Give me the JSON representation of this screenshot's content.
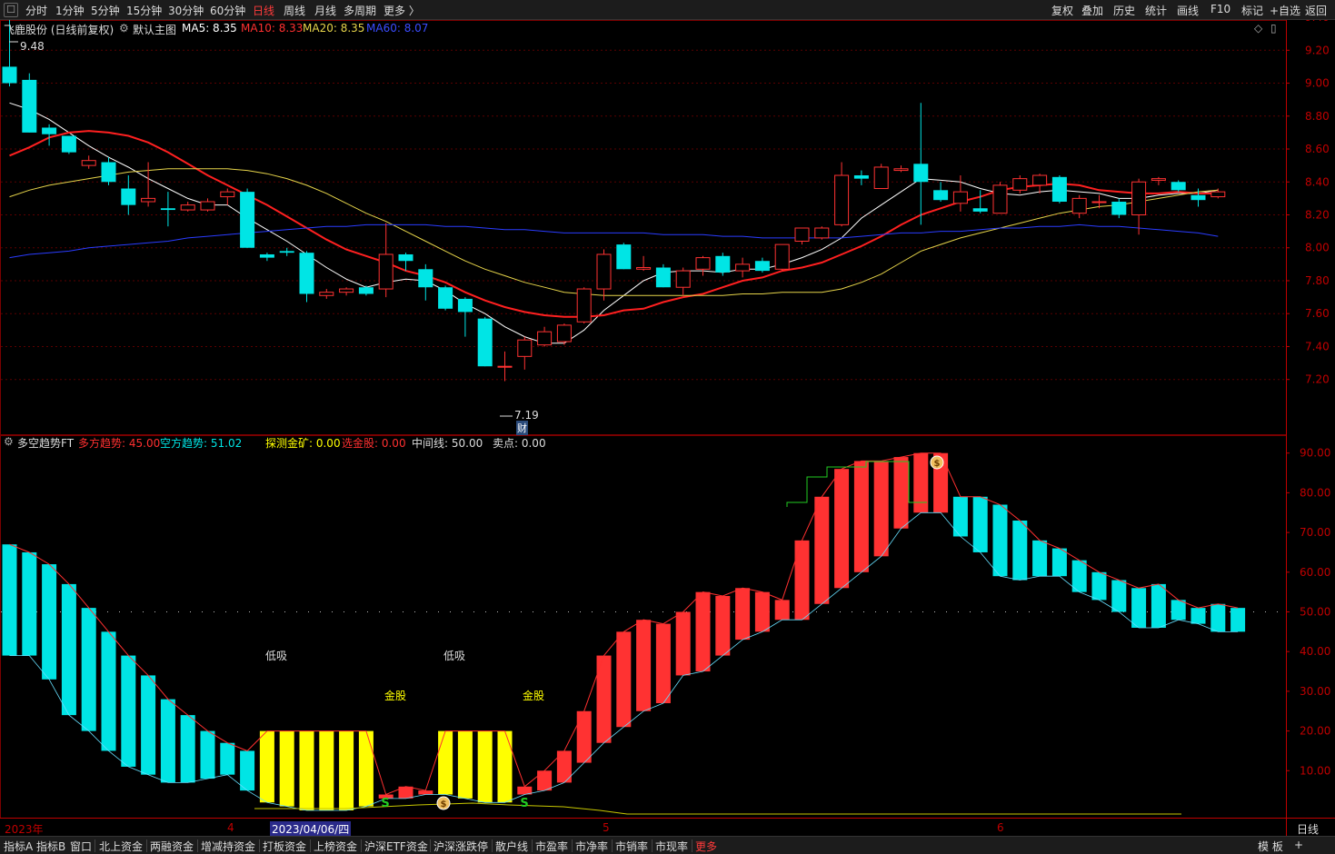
{
  "toolbar": {
    "back_icon": "back-arrow-icon",
    "periods": [
      "分时",
      "1分钟",
      "5分钟",
      "15分钟",
      "30分钟",
      "60分钟",
      "日线",
      "周线",
      "月线",
      "多周期",
      "更多 〉"
    ],
    "active_period": "日线",
    "right_tools": [
      "复权",
      "叠加",
      "历史",
      "统计",
      "画线",
      "F10",
      "标记",
      "+自选",
      "返回"
    ]
  },
  "main_panel": {
    "stock_title": "飞鹿股份 (日线前复权)",
    "template_label": "默认主图",
    "ma5_label": "MA5: 8.35",
    "ma10_label": "MA10: 8.33",
    "ma20_label": "MA20: 8.35",
    "ma60_label": "MA60: 8.07",
    "high_marker": "9.48",
    "low_marker": "7.19",
    "finance_badge": "财"
  },
  "sub_panel": {
    "indicator_name": "多空趋势FT",
    "bull_label": "多方趋势: 45.00",
    "bear_label": "空方趋势: 51.02",
    "probe_label": "探测金矿: 0.00",
    "pick_label": "选金股: 0.00",
    "mid_label": "中间线: 50.00",
    "sell_label": "卖点: 0.00",
    "annotations": [
      {
        "text": "低吸",
        "kind": "low_buy"
      },
      {
        "text": "低吸",
        "kind": "low_buy"
      },
      {
        "text": "金股",
        "kind": "gold"
      },
      {
        "text": "金股",
        "kind": "gold"
      }
    ]
  },
  "xaxis": {
    "labels": [
      "2023年",
      "4",
      "2023/04/06/四",
      "5",
      "6"
    ],
    "period_label": "日线"
  },
  "bottom_tabs": [
    "指标A",
    "指标B",
    "窗口",
    "北上资金",
    "两融资金",
    "增减持资金",
    "打板资金",
    "上榜资金",
    "沪深ETF资金",
    "沪深涨跌停",
    "散户线",
    "市盈率",
    "市净率",
    "市销率",
    "市现率",
    "更多"
  ],
  "bottom_right": [
    "模 板",
    "+"
  ],
  "colors": {
    "up": "#ff3232",
    "down": "#00e5e5",
    "ma5": "#ffffff",
    "ma10": "#ff2020",
    "ma20": "#e6d44a",
    "ma60": "#2a3cff",
    "yellow_bar": "#ffff00",
    "axis": "#c00000"
  },
  "chart_data": [
    {
      "type": "candlestick",
      "title": "飞鹿股份 (日线前复权)",
      "ylim": [
        7.1,
        9.6
      ],
      "yticks": [
        7.2,
        7.4,
        7.6,
        7.8,
        8.0,
        8.2,
        8.4,
        8.6,
        8.8,
        9.0,
        9.2,
        9.4
      ],
      "candles": [
        {
          "o": 9.1,
          "h": 9.48,
          "l": 8.98,
          "c": 9.0
        },
        {
          "o": 9.02,
          "h": 9.06,
          "l": 8.7,
          "c": 8.7
        },
        {
          "o": 8.73,
          "h": 8.75,
          "l": 8.62,
          "c": 8.69
        },
        {
          "o": 8.68,
          "h": 8.68,
          "l": 8.57,
          "c": 8.58
        },
        {
          "o": 8.5,
          "h": 8.56,
          "l": 8.48,
          "c": 8.53
        },
        {
          "o": 8.52,
          "h": 8.55,
          "l": 8.38,
          "c": 8.4
        },
        {
          "o": 8.36,
          "h": 8.44,
          "l": 8.2,
          "c": 8.26
        },
        {
          "o": 8.28,
          "h": 8.52,
          "l": 8.25,
          "c": 8.3
        },
        {
          "o": 8.24,
          "h": 8.34,
          "l": 8.13,
          "c": 8.23
        },
        {
          "o": 8.23,
          "h": 8.28,
          "l": 8.22,
          "c": 8.26
        },
        {
          "o": 8.23,
          "h": 8.3,
          "l": 8.22,
          "c": 8.28
        },
        {
          "o": 8.31,
          "h": 8.36,
          "l": 8.26,
          "c": 8.34
        },
        {
          "o": 8.34,
          "h": 8.36,
          "l": 8.0,
          "c": 8.0
        },
        {
          "o": 7.96,
          "h": 7.97,
          "l": 7.92,
          "c": 7.94
        },
        {
          "o": 7.98,
          "h": 8.0,
          "l": 7.95,
          "c": 7.97
        },
        {
          "o": 7.97,
          "h": 7.98,
          "l": 7.67,
          "c": 7.72
        },
        {
          "o": 7.71,
          "h": 7.75,
          "l": 7.69,
          "c": 7.73
        },
        {
          "o": 7.73,
          "h": 7.76,
          "l": 7.71,
          "c": 7.75
        },
        {
          "o": 7.76,
          "h": 7.77,
          "l": 7.71,
          "c": 7.72
        },
        {
          "o": 7.75,
          "h": 8.15,
          "l": 7.7,
          "c": 7.96
        },
        {
          "o": 7.96,
          "h": 7.97,
          "l": 7.86,
          "c": 7.92
        },
        {
          "o": 7.87,
          "h": 7.9,
          "l": 7.68,
          "c": 7.76
        },
        {
          "o": 7.76,
          "h": 7.77,
          "l": 7.62,
          "c": 7.63
        },
        {
          "o": 7.69,
          "h": 7.7,
          "l": 7.46,
          "c": 7.61
        },
        {
          "o": 7.57,
          "h": 7.58,
          "l": 7.28,
          "c": 7.28
        },
        {
          "o": 7.28,
          "h": 7.37,
          "l": 7.19,
          "c": 7.28
        },
        {
          "o": 7.34,
          "h": 7.46,
          "l": 7.26,
          "c": 7.44
        },
        {
          "o": 7.41,
          "h": 7.52,
          "l": 7.4,
          "c": 7.49
        },
        {
          "o": 7.43,
          "h": 7.54,
          "l": 7.41,
          "c": 7.53
        },
        {
          "o": 7.55,
          "h": 7.76,
          "l": 7.54,
          "c": 7.75
        },
        {
          "o": 7.75,
          "h": 7.99,
          "l": 7.68,
          "c": 7.96
        },
        {
          "o": 8.02,
          "h": 8.03,
          "l": 7.87,
          "c": 7.87
        },
        {
          "o": 7.87,
          "h": 7.95,
          "l": 7.86,
          "c": 7.88
        },
        {
          "o": 7.88,
          "h": 7.9,
          "l": 7.76,
          "c": 7.76
        },
        {
          "o": 7.76,
          "h": 7.88,
          "l": 7.71,
          "c": 7.86
        },
        {
          "o": 7.87,
          "h": 7.95,
          "l": 7.83,
          "c": 7.94
        },
        {
          "o": 7.95,
          "h": 7.97,
          "l": 7.83,
          "c": 7.85
        },
        {
          "o": 7.86,
          "h": 7.94,
          "l": 7.82,
          "c": 7.9
        },
        {
          "o": 7.92,
          "h": 7.94,
          "l": 7.85,
          "c": 7.86
        },
        {
          "o": 7.87,
          "h": 8.02,
          "l": 7.86,
          "c": 8.02
        },
        {
          "o": 8.04,
          "h": 8.12,
          "l": 8.02,
          "c": 8.12
        },
        {
          "o": 8.06,
          "h": 8.13,
          "l": 8.05,
          "c": 8.12
        },
        {
          "o": 8.14,
          "h": 8.52,
          "l": 8.13,
          "c": 8.44
        },
        {
          "o": 8.44,
          "h": 8.47,
          "l": 8.38,
          "c": 8.42
        },
        {
          "o": 8.36,
          "h": 8.51,
          "l": 8.36,
          "c": 8.49
        },
        {
          "o": 8.47,
          "h": 8.5,
          "l": 8.46,
          "c": 8.48
        },
        {
          "o": 8.51,
          "h": 8.88,
          "l": 8.14,
          "c": 8.4
        },
        {
          "o": 8.35,
          "h": 8.4,
          "l": 8.28,
          "c": 8.29
        },
        {
          "o": 8.27,
          "h": 8.44,
          "l": 8.22,
          "c": 8.34
        },
        {
          "o": 8.24,
          "h": 8.35,
          "l": 8.21,
          "c": 8.22
        },
        {
          "o": 8.21,
          "h": 8.4,
          "l": 8.21,
          "c": 8.38
        },
        {
          "o": 8.35,
          "h": 8.44,
          "l": 8.33,
          "c": 8.42
        },
        {
          "o": 8.38,
          "h": 8.45,
          "l": 8.33,
          "c": 8.44
        },
        {
          "o": 8.43,
          "h": 8.44,
          "l": 8.27,
          "c": 8.28
        },
        {
          "o": 8.21,
          "h": 8.32,
          "l": 8.18,
          "c": 8.3
        },
        {
          "o": 8.28,
          "h": 8.32,
          "l": 8.24,
          "c": 8.28
        },
        {
          "o": 8.28,
          "h": 8.3,
          "l": 8.18,
          "c": 8.2
        },
        {
          "o": 8.2,
          "h": 8.42,
          "l": 8.08,
          "c": 8.4
        },
        {
          "o": 8.41,
          "h": 8.43,
          "l": 8.38,
          "c": 8.42
        },
        {
          "o": 8.4,
          "h": 8.41,
          "l": 8.34,
          "c": 8.35
        },
        {
          "o": 8.32,
          "h": 8.36,
          "l": 8.25,
          "c": 8.29
        },
        {
          "o": 8.31,
          "h": 8.36,
          "l": 8.3,
          "c": 8.34
        }
      ],
      "series": [
        {
          "name": "MA5",
          "values": [
            8.88,
            8.84,
            8.78,
            8.7,
            8.62,
            8.55,
            8.49,
            8.42,
            8.36,
            8.3,
            8.26,
            8.26,
            8.18,
            8.11,
            8.04,
            7.96,
            7.88,
            7.81,
            7.76,
            7.79,
            7.81,
            7.8,
            7.74,
            7.66,
            7.6,
            7.52,
            7.46,
            7.42,
            7.42,
            7.5,
            7.62,
            7.71,
            7.8,
            7.85,
            7.86,
            7.86,
            7.85,
            7.87,
            7.87,
            7.9,
            7.94,
            7.99,
            8.06,
            8.18,
            8.26,
            8.34,
            8.42,
            8.41,
            8.4,
            8.36,
            8.33,
            8.32,
            8.34,
            8.35,
            8.34,
            8.33,
            8.3,
            8.3,
            8.32,
            8.33,
            8.33,
            8.35
          ]
        },
        {
          "name": "MA10",
          "values": [
            8.56,
            8.61,
            8.67,
            8.7,
            8.71,
            8.7,
            8.68,
            8.64,
            8.58,
            8.51,
            8.44,
            8.38,
            8.32,
            8.26,
            8.19,
            8.12,
            8.05,
            7.99,
            7.95,
            7.91,
            7.86,
            7.83,
            7.79,
            7.73,
            7.68,
            7.64,
            7.61,
            7.59,
            7.58,
            7.58,
            7.59,
            7.62,
            7.63,
            7.67,
            7.7,
            7.72,
            7.76,
            7.8,
            7.82,
            7.86,
            7.88,
            7.91,
            7.96,
            8.01,
            8.07,
            8.14,
            8.2,
            8.24,
            8.28,
            8.31,
            8.35,
            8.37,
            8.38,
            8.39,
            8.38,
            8.35,
            8.34,
            8.33,
            8.33,
            8.34,
            8.33,
            8.33
          ]
        },
        {
          "name": "MA20",
          "values": [
            8.31,
            8.35,
            8.38,
            8.4,
            8.42,
            8.44,
            8.46,
            8.47,
            8.48,
            8.48,
            8.48,
            8.48,
            8.47,
            8.45,
            8.42,
            8.38,
            8.33,
            8.27,
            8.21,
            8.16,
            8.1,
            8.04,
            7.98,
            7.92,
            7.87,
            7.83,
            7.79,
            7.76,
            7.73,
            7.72,
            7.71,
            7.71,
            7.71,
            7.71,
            7.71,
            7.71,
            7.71,
            7.72,
            7.72,
            7.73,
            7.73,
            7.73,
            7.75,
            7.79,
            7.84,
            7.91,
            7.98,
            8.02,
            8.06,
            8.09,
            8.12,
            8.15,
            8.18,
            8.21,
            8.23,
            8.25,
            8.26,
            8.28,
            8.3,
            8.32,
            8.34,
            8.35
          ]
        },
        {
          "name": "MA60",
          "values": [
            7.94,
            7.96,
            7.97,
            7.98,
            8.0,
            8.01,
            8.02,
            8.03,
            8.04,
            8.06,
            8.07,
            8.08,
            8.09,
            8.1,
            8.11,
            8.12,
            8.13,
            8.13,
            8.14,
            8.14,
            8.14,
            8.14,
            8.13,
            8.13,
            8.12,
            8.11,
            8.11,
            8.1,
            8.09,
            8.09,
            8.09,
            8.09,
            8.09,
            8.08,
            8.08,
            8.08,
            8.07,
            8.07,
            8.06,
            8.06,
            8.06,
            8.06,
            8.06,
            8.07,
            8.08,
            8.09,
            8.09,
            8.1,
            8.1,
            8.11,
            8.12,
            8.12,
            8.13,
            8.13,
            8.14,
            8.13,
            8.13,
            8.12,
            8.11,
            8.1,
            8.09,
            8.07
          ]
        }
      ]
    },
    {
      "type": "bar",
      "title": "多空趋势FT",
      "ylim": [
        0,
        95
      ],
      "yticks": [
        10,
        20,
        30,
        40,
        50,
        60,
        70,
        80,
        90
      ],
      "midline": 50,
      "bars": [
        {
          "from": 67,
          "to": 39,
          "color": "cyan"
        },
        {
          "from": 65,
          "to": 39,
          "color": "cyan"
        },
        {
          "from": 62,
          "to": 33,
          "color": "cyan"
        },
        {
          "from": 57,
          "to": 24,
          "color": "cyan"
        },
        {
          "from": 51,
          "to": 20,
          "color": "cyan"
        },
        {
          "from": 45,
          "to": 15,
          "color": "cyan"
        },
        {
          "from": 39,
          "to": 11,
          "color": "cyan"
        },
        {
          "from": 34,
          "to": 9,
          "color": "cyan"
        },
        {
          "from": 28,
          "to": 7,
          "color": "cyan"
        },
        {
          "from": 24,
          "to": 7,
          "color": "cyan"
        },
        {
          "from": 20,
          "to": 8,
          "color": "cyan"
        },
        {
          "from": 17,
          "to": 9,
          "color": "cyan"
        },
        {
          "from": 15,
          "to": 5,
          "color": "cyan"
        },
        {
          "from": 20,
          "to": 2,
          "color": "yellow"
        },
        {
          "from": 20,
          "to": 1,
          "color": "yellow"
        },
        {
          "from": 20,
          "to": 0,
          "color": "yellow"
        },
        {
          "from": 20,
          "to": 0,
          "color": "yellow"
        },
        {
          "from": 20,
          "to": 0,
          "color": "yellow"
        },
        {
          "from": 20,
          "to": 1,
          "color": "yellow"
        },
        {
          "from": 4,
          "to": 3,
          "color": "red"
        },
        {
          "from": 6,
          "to": 3,
          "color": "red"
        },
        {
          "from": 5,
          "to": 4,
          "color": "red"
        },
        {
          "from": 20,
          "to": 4,
          "color": "yellow"
        },
        {
          "from": 20,
          "to": 3,
          "color": "yellow"
        },
        {
          "from": 20,
          "to": 2,
          "color": "yellow"
        },
        {
          "from": 20,
          "to": 2,
          "color": "yellow"
        },
        {
          "from": 6,
          "to": 4,
          "color": "red"
        },
        {
          "from": 10,
          "to": 5,
          "color": "red"
        },
        {
          "from": 15,
          "to": 7,
          "color": "red"
        },
        {
          "from": 25,
          "to": 12,
          "color": "red"
        },
        {
          "from": 39,
          "to": 17,
          "color": "red"
        },
        {
          "from": 45,
          "to": 21,
          "color": "red"
        },
        {
          "from": 48,
          "to": 25,
          "color": "red"
        },
        {
          "from": 47,
          "to": 27,
          "color": "red"
        },
        {
          "from": 50,
          "to": 34,
          "color": "red"
        },
        {
          "from": 55,
          "to": 35,
          "color": "red"
        },
        {
          "from": 54,
          "to": 39,
          "color": "red"
        },
        {
          "from": 56,
          "to": 43,
          "color": "red"
        },
        {
          "from": 55,
          "to": 45,
          "color": "red"
        },
        {
          "from": 53,
          "to": 48,
          "color": "red"
        },
        {
          "from": 68,
          "to": 48,
          "color": "red"
        },
        {
          "from": 79,
          "to": 52,
          "color": "red"
        },
        {
          "from": 86,
          "to": 56,
          "color": "red"
        },
        {
          "from": 88,
          "to": 60,
          "color": "red"
        },
        {
          "from": 88,
          "to": 64,
          "color": "red"
        },
        {
          "from": 89,
          "to": 71,
          "color": "red"
        },
        {
          "from": 90,
          "to": 75,
          "color": "red"
        },
        {
          "from": 90,
          "to": 75,
          "color": "red"
        },
        {
          "from": 79,
          "to": 69,
          "color": "cyan"
        },
        {
          "from": 79,
          "to": 65,
          "color": "cyan"
        },
        {
          "from": 77,
          "to": 59,
          "color": "cyan"
        },
        {
          "from": 73,
          "to": 58,
          "color": "cyan"
        },
        {
          "from": 68,
          "to": 59,
          "color": "cyan"
        },
        {
          "from": 66,
          "to": 59,
          "color": "cyan"
        },
        {
          "from": 63,
          "to": 55,
          "color": "cyan"
        },
        {
          "from": 60,
          "to": 53,
          "color": "cyan"
        },
        {
          "from": 58,
          "to": 50,
          "color": "cyan"
        },
        {
          "from": 56,
          "to": 46,
          "color": "cyan"
        },
        {
          "from": 57,
          "to": 46,
          "color": "cyan"
        },
        {
          "from": 53,
          "to": 48,
          "color": "cyan"
        },
        {
          "from": 51,
          "to": 47,
          "color": "cyan"
        },
        {
          "from": 52,
          "to": 45,
          "color": "cyan"
        },
        {
          "from": 51,
          "to": 45,
          "color": "cyan"
        }
      ]
    }
  ]
}
